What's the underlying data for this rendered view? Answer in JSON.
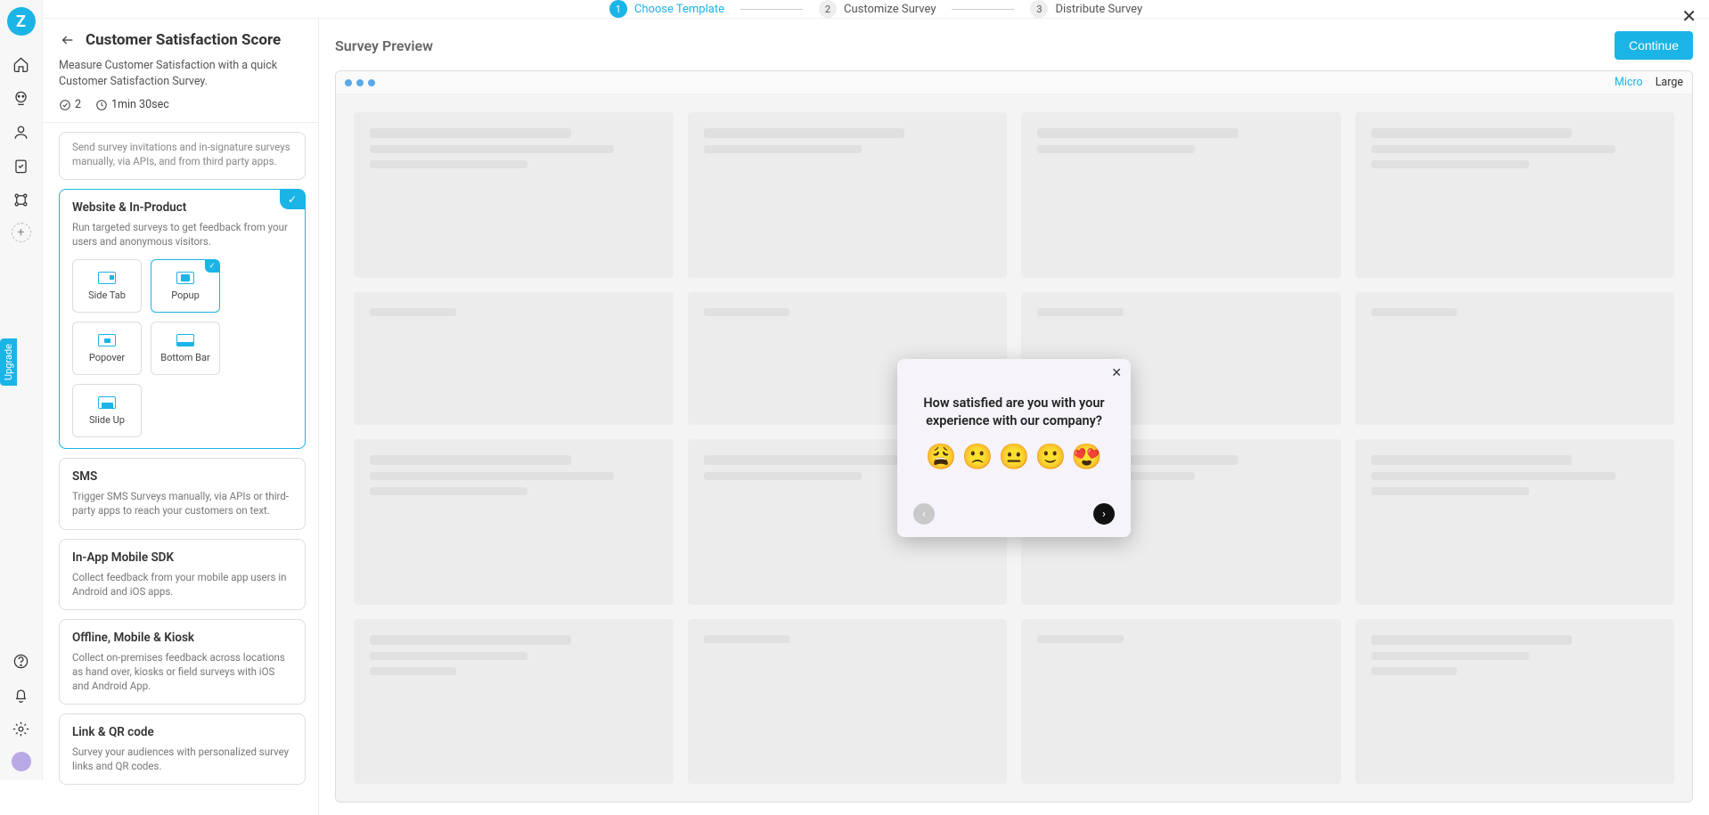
{
  "logo_letter": "Z",
  "upgrade_label": "Upgrade",
  "stepper": {
    "steps": [
      {
        "num": "1",
        "label": "Choose Template"
      },
      {
        "num": "2",
        "label": "Customize Survey"
      },
      {
        "num": "3",
        "label": "Distribute Survey"
      }
    ]
  },
  "sidebar": {
    "title": "Customer Satisfaction Score",
    "description": "Measure Customer Satisfaction with a quick Customer Satisfaction Survey.",
    "question_count": "2",
    "duration": "1min 30sec",
    "channels": {
      "truncated_desc": "Send survey invitations and in-signature surveys manually, via APIs, and from third party apps.",
      "web": {
        "title": "Website & In-Product",
        "desc": "Run targeted surveys to get feedback from your users and anonymous visitors.",
        "subopts": [
          "Side Tab",
          "Popup",
          "Popover",
          "Bottom Bar",
          "Slide Up"
        ]
      },
      "sms": {
        "title": "SMS",
        "desc": "Trigger SMS Surveys manually, via APIs or third-party apps to reach your customers on text."
      },
      "sdk": {
        "title": "In-App Mobile SDK",
        "desc": "Collect feedback from your mobile app users in Android and iOS apps."
      },
      "offline": {
        "title": "Offline, Mobile & Kiosk",
        "desc": "Collect on-premises feedback across locations as hand over, kiosks or field surveys with iOS and Android App."
      },
      "link": {
        "title": "Link & QR code",
        "desc": "Survey your audiences with personalized survey links and QR codes."
      }
    }
  },
  "preview": {
    "title": "Survey Preview",
    "continue": "Continue",
    "size_micro": "Micro",
    "size_large": "Large",
    "popup": {
      "question": "How satisfied are you with your experience with our company?",
      "emojis": [
        "😩",
        "🙁",
        "😐",
        "🙂",
        "😍"
      ]
    }
  }
}
